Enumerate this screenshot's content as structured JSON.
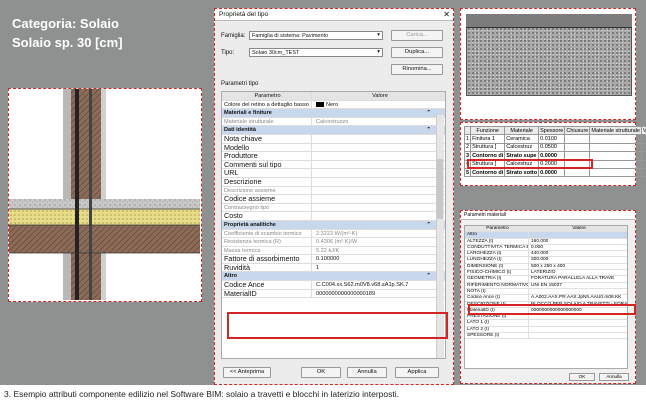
{
  "category_title": "Categoria: Solaio",
  "subtitle": "Solaio sp. 30 [cm]",
  "caption": "3. Esempio attributi componente edilizio nel Software BIM: solaio a travetti e blocchi in laterizio interposti.",
  "type_dialog": {
    "title": "Proprietà del tipo",
    "close_glyph": "✕",
    "family_label": "Famiglia:",
    "family_value": "Famiglia di sistema: Pavimento",
    "load_button": "Carica...",
    "type_label": "Tipo:",
    "type_value": "Solaio 30cm_TEST",
    "duplicate_button": "Duplica...",
    "rename_button": "Rinomina...",
    "params_label": "Parametri tipo",
    "col_param": "Parametro",
    "col_value": "Valore",
    "rows": [
      {
        "k": "Colore del retino a dettaglio basso",
        "v": "Nero",
        "kind": "swatch"
      },
      {
        "k": "Materiali e finiture",
        "kind": "section"
      },
      {
        "k": "Materiale strutturale",
        "v": "Calcestruzzo",
        "kind": "dim"
      },
      {
        "k": "Dati identità",
        "kind": "section"
      },
      {
        "k": "Nota chiave",
        "v": "",
        "kind": "big"
      },
      {
        "k": "Modello",
        "v": "",
        "kind": "big"
      },
      {
        "k": "Produttore",
        "v": "",
        "kind": "big"
      },
      {
        "k": "Commenti sul tipo",
        "v": "",
        "kind": "big"
      },
      {
        "k": "URL",
        "v": "",
        "kind": "big"
      },
      {
        "k": "Descrizione",
        "v": "",
        "kind": "big"
      },
      {
        "k": "Descrizione assieme",
        "v": "",
        "kind": "dim"
      },
      {
        "k": "Codice assieme",
        "v": "",
        "kind": "big"
      },
      {
        "k": "Contrassegno tipo",
        "v": "",
        "kind": "dim"
      },
      {
        "k": "Costo",
        "v": "",
        "kind": "big"
      },
      {
        "k": "Proprietà analitiche",
        "kind": "section"
      },
      {
        "k": "Coefficiente di scambio termico",
        "v": "2.3222 W/(m²·K)",
        "kind": "dim"
      },
      {
        "k": "Resistenza termica (R)",
        "v": "0.4306 (m²·K)/W",
        "kind": "dim"
      },
      {
        "k": "Massa termica",
        "v": "5.22 kJ/K",
        "kind": "dim"
      },
      {
        "k": "Fattore di assorbimento",
        "v": "0.100000",
        "kind": "big"
      },
      {
        "k": "Ruvidità",
        "v": "1",
        "kind": "big"
      },
      {
        "k": "Altro",
        "kind": "section"
      },
      {
        "k": "Codice Ance",
        "v": "C.C004.xx.S62.m0V8.v68.sA1p.SK.7",
        "kind": "big"
      },
      {
        "k": "MaterialID",
        "v": "0000000000000000189",
        "kind": "big"
      }
    ],
    "preview_button": "<< Anteprima",
    "ok_button": "OK",
    "cancel_button": "Annulla",
    "apply_button": "Applica"
  },
  "structure_table": {
    "headers": [
      "",
      "Funzione",
      "Materiale",
      "Spessore",
      "Chiusure",
      "Materiale strutturale",
      "Variabile"
    ],
    "rows": [
      [
        "1",
        "Finitura 1",
        "Ceramica",
        "0.0100",
        "",
        "",
        ""
      ],
      [
        "2",
        "Struttura [",
        "Calcestruz",
        "0.0500",
        "",
        "",
        ""
      ],
      [
        "3",
        "Contorno di",
        "Strato supe",
        "0.0000",
        "",
        "",
        ""
      ],
      [
        "4",
        "Struttura [",
        "Calcestruz",
        "0.2000",
        "",
        "",
        ""
      ],
      [
        "5",
        "Contorno di",
        "Strato sotto",
        "0.0000",
        "",
        "",
        ""
      ]
    ]
  },
  "material_dialog": {
    "title": "Parametri materiali",
    "col_param": "Parametro",
    "col_value": "Valore",
    "rows": [
      {
        "k": "Altro",
        "v": "",
        "section": true
      },
      {
        "k": "ALTEZZA (t)",
        "v": "160.000"
      },
      {
        "k": "CONDUTTIVITÀ TERMICA E",
        "v": "0.000"
      },
      {
        "k": "LARGHEZZA (t)",
        "v": "440.000"
      },
      {
        "k": "LUNGHEZZA (t)",
        "v": "200.000"
      },
      {
        "k": "DIMENSIONE (t)",
        "v": "500 x 250 x 400"
      },
      {
        "k": "FISICO-CHIMICO (t)",
        "v": "LATERIZIO"
      },
      {
        "k": "GEOMETRIA (t)",
        "v": "FORATURA PARALLELA ALLA TRAVE"
      },
      {
        "k": "RIFERIMENTO NORMATIVO",
        "v": "UNI EN 15037"
      },
      {
        "k": "NOTA (t)",
        "v": ""
      },
      {
        "k": "Codice Ance (t)",
        "v": "A.A002.AAX.PR.AAX.JpNh.AAU0.m08.KK"
      },
      {
        "k": "DESCRIZIONE (t)",
        "v": "BLOCCO PER SOLAIO A TRAVETTI - FORATO"
      },
      {
        "k": "MaterialID (t)",
        "v": "0000000000000000000"
      },
      {
        "k": "PRESTAZIONE (t)",
        "v": ""
      },
      {
        "k": "LATO 1 (t)",
        "v": ""
      },
      {
        "k": "LATO 2 (t)",
        "v": ""
      },
      {
        "k": "SPESSORE (t)",
        "v": ""
      }
    ],
    "ok_button": "OK",
    "cancel_button": "Annulla"
  }
}
